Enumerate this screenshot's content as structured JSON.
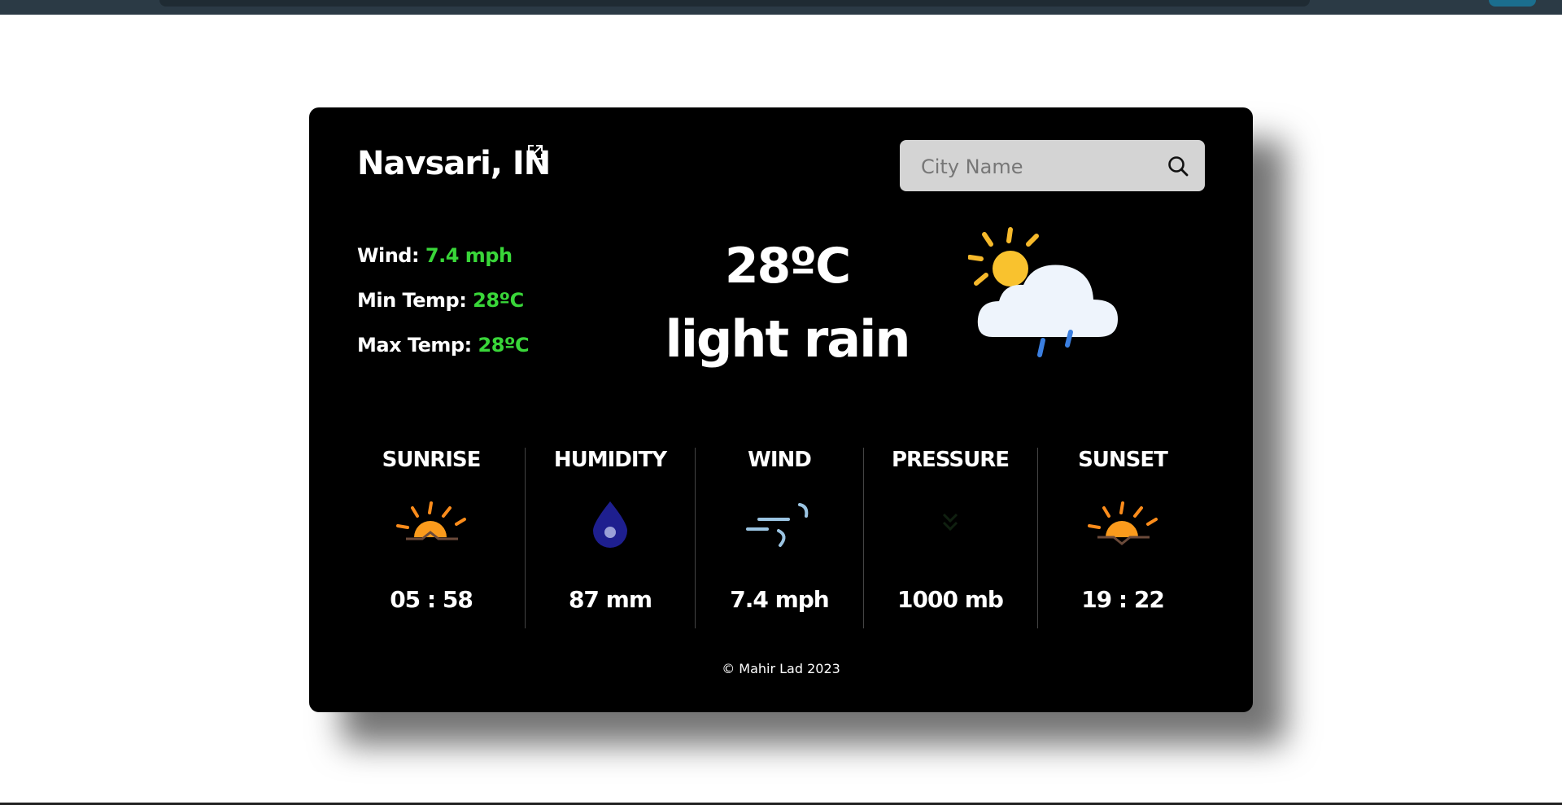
{
  "city": "Navsari, IN",
  "search": {
    "placeholder": "City Name"
  },
  "stats": {
    "wind_label": "Wind:",
    "wind_value": "7.4 mph",
    "min_label": "Min Temp:",
    "min_value": "28ºC",
    "max_label": "Max Temp:",
    "max_value": "28ºC"
  },
  "current": {
    "temperature": "28ºC",
    "description": "light rain",
    "icon": "partly-cloudy-rain-icon"
  },
  "metrics": [
    {
      "label": "SUNRISE",
      "value": "05 : 58",
      "icon": "sunrise-icon"
    },
    {
      "label": "HUMIDITY",
      "value": "87 mm",
      "icon": "water-drop-icon"
    },
    {
      "label": "WIND",
      "value": "7.4 mph",
      "icon": "wind-icon"
    },
    {
      "label": "PRESSURE",
      "value": "1000 mb",
      "icon": "pressure-icon"
    },
    {
      "label": "SUNSET",
      "value": "19 : 22",
      "icon": "sunset-icon"
    }
  ],
  "footer": "© Mahir Lad 2023",
  "colors": {
    "accent": "#39d639",
    "card": "#000000",
    "search_bg": "#d4d4d4"
  }
}
